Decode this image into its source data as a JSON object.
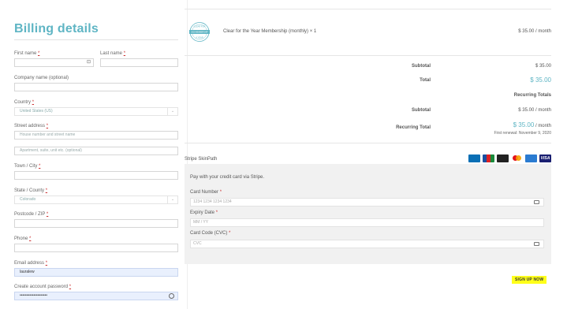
{
  "billing": {
    "title": "Billing details",
    "first_name_label": "First name",
    "last_name_label": "Last name",
    "company_label": "Company name (optional)",
    "country_label": "Country",
    "country_value": "United States (US)",
    "street_label": "Street address",
    "street_placeholder": "House number and street name",
    "apartment_placeholder": "Apartment, suite, unit etc. (optional)",
    "town_label": "Town / City",
    "state_label": "State / County",
    "state_value": "Colorado",
    "postcode_label": "Postcode / ZIP",
    "phone_label": "Phone",
    "email_label": "Email address",
    "email_value": "lauralew",
    "password_label": "Create account password",
    "password_value": "••••••••••••••••••••",
    "required_mark": "*"
  },
  "order": {
    "item_name": "Clear for the Year Membership (monthly)  × 1",
    "item_price": "$ 35.00 / month",
    "badge_top": "CLEAR FOR",
    "badge_mid": "2020 MEMBERSHIP",
    "badge_bottom": "A YEAR",
    "subtotal_label": "Subtotal",
    "subtotal_value": "$ 35.00",
    "total_label": "Total",
    "total_value": "$ 35.00",
    "recurring_heading": "Recurring Totals",
    "recurring_subtotal_label": "Subtotal",
    "recurring_subtotal_value": "$ 35.00 / month",
    "recurring_total_label": "Recurring Total",
    "recurring_total_amount": "$ 35.00",
    "recurring_total_period": " / month",
    "first_renewal": "First renewal: November 9, 2020"
  },
  "payment": {
    "method_title": "Stripe SkinPath",
    "intro": "Pay with your credit card via Stripe.",
    "card_number_label": "Card Number",
    "card_number_placeholder": "1234 1234 1234 1234",
    "expiry_label": "Expiry Date",
    "expiry_placeholder": "MM / YY",
    "cvc_label": "Card Code (CVC)",
    "cvc_placeholder": "CVC",
    "card_brands": [
      "diners-icon",
      "jcb-icon",
      "discover-icon",
      "mastercard-icon",
      "amex-icon",
      "visa-icon"
    ],
    "visa_text": "VISA"
  },
  "actions": {
    "signup_label": "SIGN UP NOW"
  },
  "colors": {
    "accent": "#5fb5c4",
    "highlight": "#ffff1a",
    "autofill": "#e9f0fd"
  }
}
